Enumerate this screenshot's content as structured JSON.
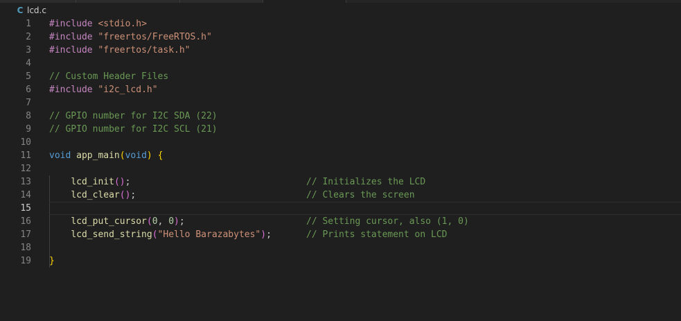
{
  "breadcrumb": {
    "file_icon": "C",
    "file_name": "lcd.c",
    "icon_color": "#519aba"
  },
  "colors": {
    "background": "#1f1f1f",
    "preprocessor": "#c586c0",
    "string": "#ce9178",
    "comment": "#6a9955",
    "keyword": "#569cd6",
    "function": "#dcdcaa",
    "number": "#b5cea8",
    "bracket": "#ffd700"
  },
  "editor": {
    "current_line": 15,
    "lines": [
      {
        "n": "1",
        "tokens": [
          [
            "inc",
            "#include"
          ],
          [
            "pl",
            " "
          ],
          [
            "str",
            "<stdio.h>"
          ]
        ]
      },
      {
        "n": "2",
        "tokens": [
          [
            "inc",
            "#include"
          ],
          [
            "pl",
            " "
          ],
          [
            "str",
            "\"freertos/FreeRTOS.h\""
          ]
        ]
      },
      {
        "n": "3",
        "tokens": [
          [
            "inc",
            "#include"
          ],
          [
            "pl",
            " "
          ],
          [
            "str",
            "\"freertos/task.h\""
          ]
        ]
      },
      {
        "n": "4",
        "tokens": []
      },
      {
        "n": "5",
        "tokens": [
          [
            "com",
            "// Custom Header Files"
          ]
        ]
      },
      {
        "n": "6",
        "tokens": [
          [
            "inc",
            "#include"
          ],
          [
            "pl",
            " "
          ],
          [
            "str",
            "\"i2c_lcd.h\""
          ]
        ]
      },
      {
        "n": "7",
        "tokens": []
      },
      {
        "n": "8",
        "tokens": [
          [
            "com",
            "// GPIO number for I2C SDA (22)"
          ]
        ]
      },
      {
        "n": "9",
        "tokens": [
          [
            "com",
            "// GPIO number for I2C SCL (21)"
          ]
        ]
      },
      {
        "n": "10",
        "tokens": []
      },
      {
        "n": "11",
        "tokens": [
          [
            "kw",
            "void"
          ],
          [
            "pl",
            " "
          ],
          [
            "fn",
            "app_main"
          ],
          [
            "br",
            "("
          ],
          [
            "kw",
            "void"
          ],
          [
            "br",
            ")"
          ],
          [
            "pl",
            " "
          ],
          [
            "br",
            "{"
          ]
        ]
      },
      {
        "n": "12",
        "tokens": []
      },
      {
        "n": "13",
        "tokens": [
          [
            "pl",
            "    "
          ],
          [
            "fn",
            "lcd_init"
          ],
          [
            "br2",
            "()"
          ],
          [
            "pl",
            ";"
          ]
        ],
        "comment": "// Initializes the LCD"
      },
      {
        "n": "14",
        "tokens": [
          [
            "pl",
            "    "
          ],
          [
            "fn",
            "lcd_clear"
          ],
          [
            "br2",
            "()"
          ],
          [
            "pl",
            ";"
          ]
        ],
        "comment": "// Clears the screen"
      },
      {
        "n": "15",
        "tokens": []
      },
      {
        "n": "16",
        "tokens": [
          [
            "pl",
            "    "
          ],
          [
            "fn",
            "lcd_put_cursor"
          ],
          [
            "br2",
            "("
          ],
          [
            "num",
            "0"
          ],
          [
            "pl",
            ", "
          ],
          [
            "num",
            "0"
          ],
          [
            "br2",
            ")"
          ],
          [
            "pl",
            ";"
          ]
        ],
        "comment": "// Setting cursor, also (1, 0)"
      },
      {
        "n": "17",
        "tokens": [
          [
            "pl",
            "    "
          ],
          [
            "fn",
            "lcd_send_string"
          ],
          [
            "br2",
            "("
          ],
          [
            "str",
            "\"Hello Barazabytes\""
          ],
          [
            "br2",
            ")"
          ],
          [
            "pl",
            ";"
          ]
        ],
        "comment": "// Prints statement on LCD"
      },
      {
        "n": "18",
        "tokens": []
      },
      {
        "n": "19",
        "tokens": [
          [
            "br",
            "}"
          ]
        ]
      }
    ]
  }
}
